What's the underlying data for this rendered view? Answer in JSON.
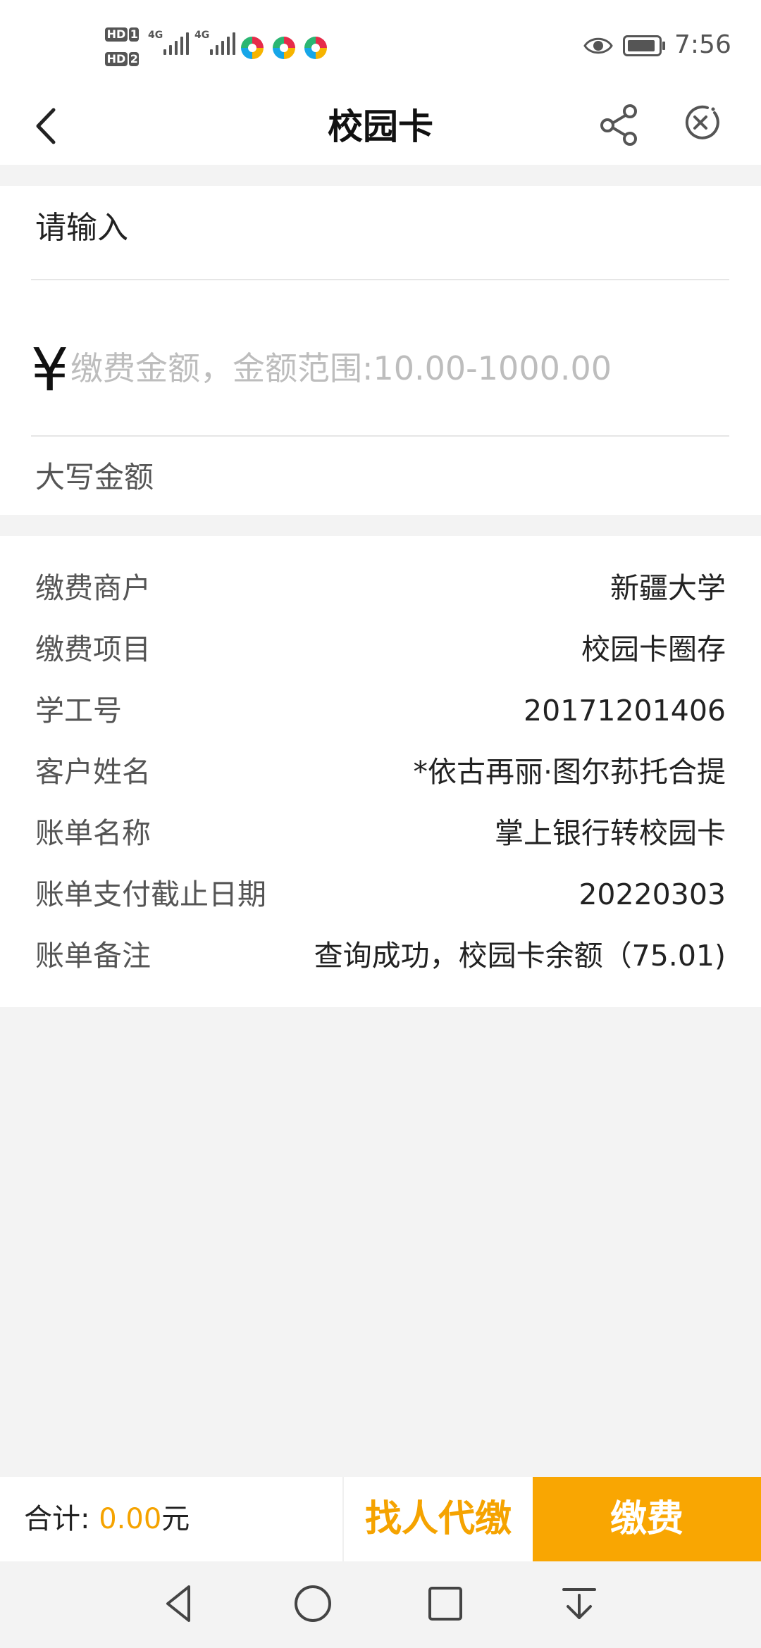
{
  "status_bar": {
    "sim1_label": "HD",
    "sim1_number": "1",
    "sim2_label": "HD",
    "sim2_number": "2",
    "network1": "4G",
    "network2": "4G",
    "time": "7:56",
    "icons": [
      "signal-icon",
      "signal-icon",
      "app-notification-icon",
      "app-notification-icon",
      "app-notification-icon",
      "eye-icon",
      "battery-icon"
    ]
  },
  "header": {
    "title": "校园卡",
    "back_icon": "chevron-left-icon",
    "share_icon": "share-icon",
    "close_icon": "close-circle-icon"
  },
  "amount": {
    "prompt": "请输入",
    "currency_symbol": "¥",
    "placeholder": "缴费金额，金额范围:10.00-1000.00",
    "value": "",
    "uppercase_label": "大写金额"
  },
  "info": {
    "rows": [
      {
        "label": "缴费商户",
        "value": "新疆大学"
      },
      {
        "label": "缴费项目",
        "value": "校园卡圈存"
      },
      {
        "label": "学工号",
        "value": "20171201406"
      },
      {
        "label": "客户姓名",
        "value": "*依古再丽·图尔荪托合提"
      },
      {
        "label": "账单名称",
        "value": "掌上银行转校园卡"
      },
      {
        "label": "账单支付截止日期",
        "value": "20220303"
      },
      {
        "label": "账单备注",
        "value": "查询成功，校园卡余额（75.01)"
      }
    ]
  },
  "footer": {
    "total_label": "合计:",
    "total_value": "0.00",
    "total_unit": "元",
    "proxy_pay_label": "找人代缴",
    "pay_label": "缴费"
  },
  "nav": {
    "icons": [
      "back-triangle-icon",
      "home-circle-icon",
      "recents-square-icon",
      "notification-pulldown-icon"
    ]
  },
  "colors": {
    "accent": "#f9a602",
    "accent_text": "#f5a300",
    "background": "#f3f3f3"
  }
}
